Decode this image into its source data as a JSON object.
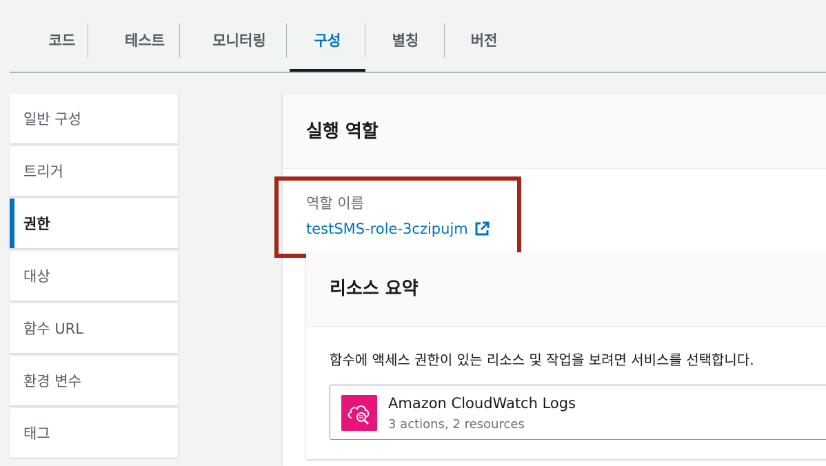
{
  "tabs": [
    {
      "label": "코드"
    },
    {
      "label": "테스트"
    },
    {
      "label": "모니터링"
    },
    {
      "label": "구성"
    },
    {
      "label": "별칭"
    },
    {
      "label": "버전"
    }
  ],
  "active_tab": "구성",
  "sidenav": {
    "items": [
      {
        "label": "일반 구성"
      },
      {
        "label": "트리거"
      },
      {
        "label": "권한"
      },
      {
        "label": "대상"
      },
      {
        "label": "함수 URL"
      },
      {
        "label": "환경 변수"
      },
      {
        "label": "태그"
      }
    ],
    "active": "권한"
  },
  "execution_role": {
    "title": "실행 역할",
    "role_name_label": "역할 이름",
    "role_name": "testSMS-role-3czipujm",
    "link_icon": "external-link-icon"
  },
  "resource_summary": {
    "title": "리소스 요약",
    "description": "함수에 액세스 권한이 있는 리소스 및 작업을 보려면 서비스를 선택합니다.",
    "services": [
      {
        "name": "Amazon CloudWatch Logs",
        "detail": "3 actions, 2 resources",
        "icon": "cloudwatch-logs-icon",
        "icon_color": "#e7157b"
      }
    ]
  },
  "colors": {
    "accent": "#0073bb",
    "highlight": "#a1271b"
  }
}
